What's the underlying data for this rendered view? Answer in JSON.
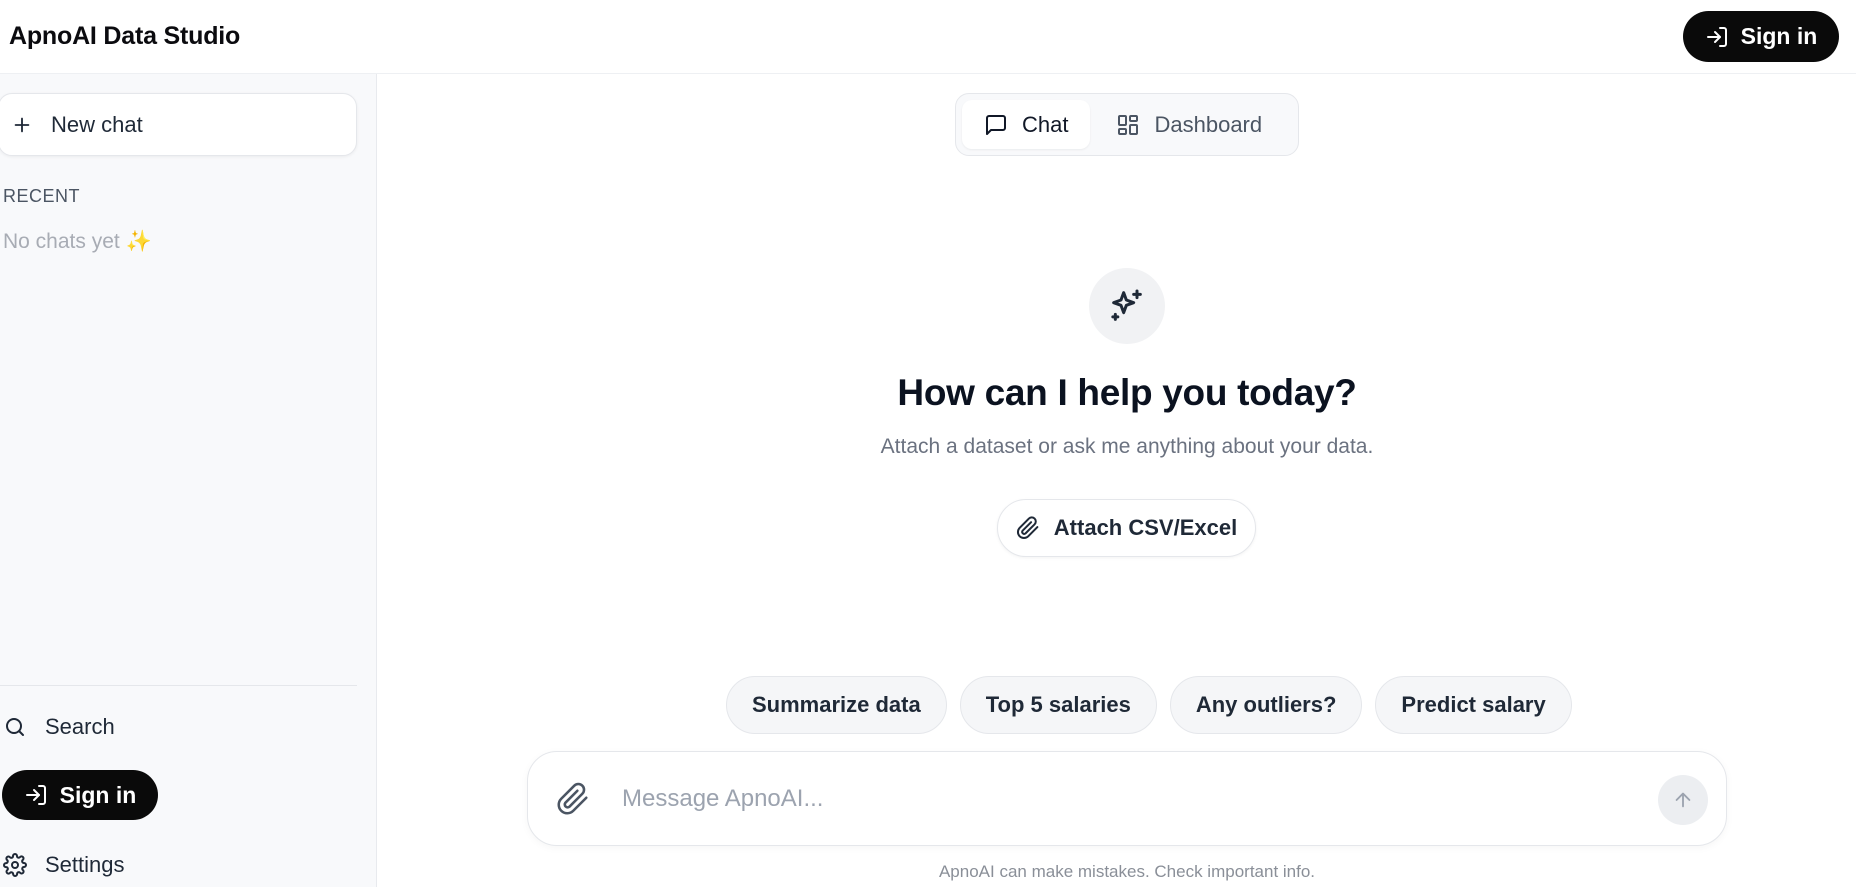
{
  "app": {
    "title": "ApnoAI Data Studio"
  },
  "header": {
    "signin_label": "Sign in"
  },
  "sidebar": {
    "new_chat_label": "New chat",
    "recent_label": "RECENT",
    "empty_text": "No chats yet ✨",
    "search_label": "Search",
    "signin_label": "Sign in",
    "settings_label": "Settings"
  },
  "tabs": [
    {
      "label": "Chat",
      "icon": "message-square-icon",
      "active": true
    },
    {
      "label": "Dashboard",
      "icon": "grid-icon",
      "active": false
    }
  ],
  "hero": {
    "icon": "sparkles-icon",
    "title": "How can I help you today?",
    "subtitle": "Attach a dataset or ask me anything about your data.",
    "attach_label": "Attach CSV/Excel"
  },
  "suggestions": [
    "Summarize data",
    "Top 5 salaries",
    "Any outliers?",
    "Predict salary"
  ],
  "composer": {
    "placeholder": "Message ApnoAI...",
    "value": ""
  },
  "footer": {
    "disclaimer": "ApnoAI can make mistakes. Check important info."
  },
  "colors": {
    "primary_button": "#0a0a0a",
    "sidebar_bg": "#f8f9fb",
    "text": "#111827",
    "muted": "#6b7280"
  }
}
